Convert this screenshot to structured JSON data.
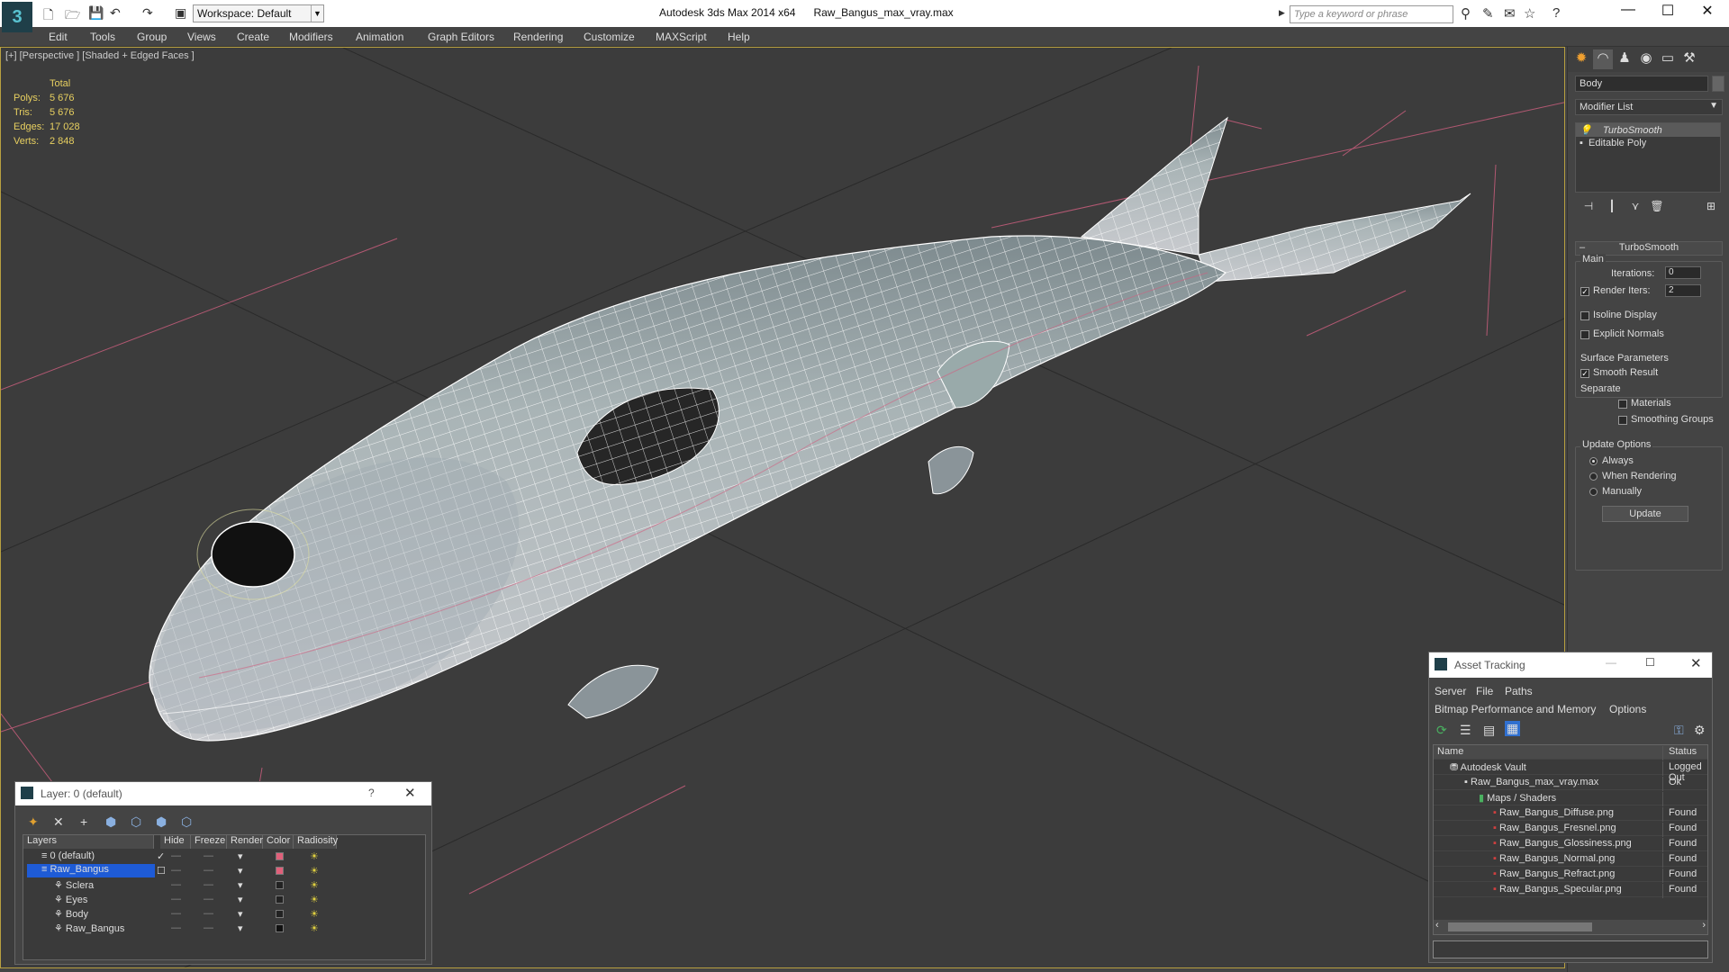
{
  "app": {
    "title": "Autodesk 3ds Max  2014 x64",
    "file": "Raw_Bangus_max_vray.max",
    "workspace": "Workspace: Default",
    "search_placeholder": "Type a keyword or phrase"
  },
  "menu": [
    "Edit",
    "Tools",
    "Group",
    "Views",
    "Create",
    "Modifiers",
    "Animation",
    "Graph Editors",
    "Rendering",
    "Customize",
    "MAXScript",
    "Help"
  ],
  "viewport": {
    "label": "[+] [Perspective ] [Shaded + Edged Faces ]",
    "stats": {
      "header": "Total",
      "polys_label": "Polys:",
      "polys": "5 676",
      "tris_label": "Tris:",
      "tris": "5 676",
      "edges_label": "Edges:",
      "edges": "17 028",
      "verts_label": "Verts:",
      "verts": "2 848"
    }
  },
  "command_panel": {
    "object_name": "Body",
    "modifier_list": "Modifier List",
    "stack": [
      "TurboSmooth",
      "Editable Poly"
    ],
    "rollout": "TurboSmooth",
    "main": "Main",
    "iterations_label": "Iterations:",
    "iterations": "0",
    "render_iters_label": "Render Iters:",
    "render_iters": "2",
    "isoline": "Isoline Display",
    "explicit_normals": "Explicit Normals",
    "surface_params": "Surface Parameters",
    "smooth_result": "Smooth Result",
    "separate": "Separate",
    "materials": "Materials",
    "smoothing_groups": "Smoothing Groups",
    "update_options": "Update Options",
    "always": "Always",
    "when_rendering": "When Rendering",
    "manually": "Manually",
    "update_button": "Update"
  },
  "layer_window": {
    "title": "Layer: 0 (default)",
    "help": "?",
    "columns": [
      "Layers",
      "Hide",
      "Freeze",
      "Render",
      "Color",
      "Radiosity"
    ],
    "rows": [
      {
        "name": "0 (default)",
        "color": "#e0607a"
      },
      {
        "name": "Raw_Bangus",
        "color": "#e0607a"
      },
      {
        "name": "Sclera",
        "color": "#222222"
      },
      {
        "name": "Eyes",
        "color": "#222222"
      },
      {
        "name": "Body",
        "color": "#222222"
      },
      {
        "name": "Raw_Bangus",
        "color": "#111111"
      }
    ]
  },
  "asset_tracking": {
    "title": "Asset Tracking",
    "menu1": [
      "Server",
      "File",
      "Paths"
    ],
    "menu2": [
      "Bitmap Performance and Memory",
      "Options"
    ],
    "columns": [
      "Name",
      "Status"
    ],
    "rows": [
      {
        "name": "Autodesk Vault",
        "status": "Logged Out"
      },
      {
        "name": "Raw_Bangus_max_vray.max",
        "status": "Ok"
      },
      {
        "name": "Maps / Shaders",
        "status": ""
      },
      {
        "name": "Raw_Bangus_Diffuse.png",
        "status": "Found"
      },
      {
        "name": "Raw_Bangus_Fresnel.png",
        "status": "Found"
      },
      {
        "name": "Raw_Bangus_Glossiness.png",
        "status": "Found"
      },
      {
        "name": "Raw_Bangus_Normal.png",
        "status": "Found"
      },
      {
        "name": "Raw_Bangus_Refract.png",
        "status": "Found"
      },
      {
        "name": "Raw_Bangus_Specular.png",
        "status": "Found"
      }
    ]
  },
  "colors": {
    "accent": "#59c3d1",
    "viewport_border": "#b8a040",
    "stats": "#e8d060",
    "selection": "#1e5bd6"
  }
}
